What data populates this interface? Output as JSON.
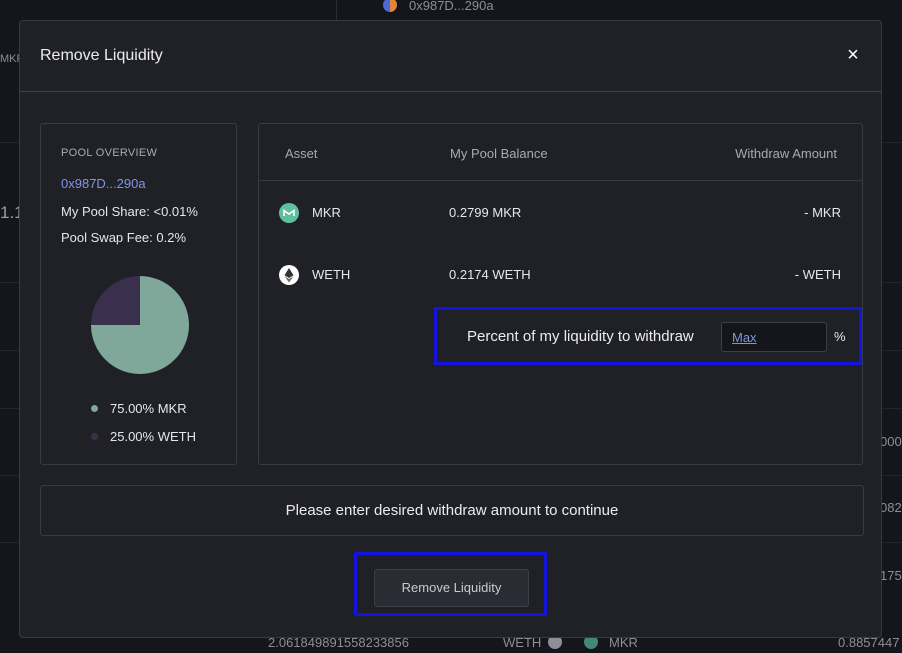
{
  "background": {
    "top_address": "0x987D...290a",
    "left_label": "MKR",
    "left_number": "1.1",
    "bottom_row": {
      "amount": "2.061849891558233856",
      "asset_a": "WETH",
      "asset_b": "MKR",
      "value": "0.8857447"
    },
    "right_edge": [
      "000",
      "082",
      "175"
    ]
  },
  "modal": {
    "title": "Remove Liquidity",
    "close_glyph": "×",
    "overview": {
      "heading": "POOL OVERVIEW",
      "address": "0x987D...290a",
      "pool_share": "My Pool Share: <0.01%",
      "swap_fee": "Pool Swap Fee: 0.2%",
      "pie": [
        {
          "label": "75.00% MKR",
          "fraction": 0.75,
          "color": "#7fa89a"
        },
        {
          "label": "25.00% WETH",
          "fraction": 0.25,
          "color": "#3a2f4c"
        }
      ]
    },
    "table": {
      "headers": {
        "asset": "Asset",
        "balance": "My Pool Balance",
        "withdraw": "Withdraw Amount"
      },
      "rows": [
        {
          "asset": "MKR",
          "balance": "0.2799 MKR",
          "withdraw": "- MKR",
          "icon": "mkr-icon",
          "icon_color": "#5fbf9f"
        },
        {
          "asset": "WETH",
          "balance": "0.2174 WETH",
          "withdraw": "- WETH",
          "icon": "ethereum-icon",
          "icon_color": "#ffffff"
        }
      ]
    },
    "percent": {
      "label": "Percent of my liquidity to withdraw",
      "input_link": "Max",
      "unit": "%"
    },
    "message": "Please enter desired withdraw amount to continue",
    "button_label": "Remove Liquidity",
    "highlight_color": "#1414e0"
  }
}
